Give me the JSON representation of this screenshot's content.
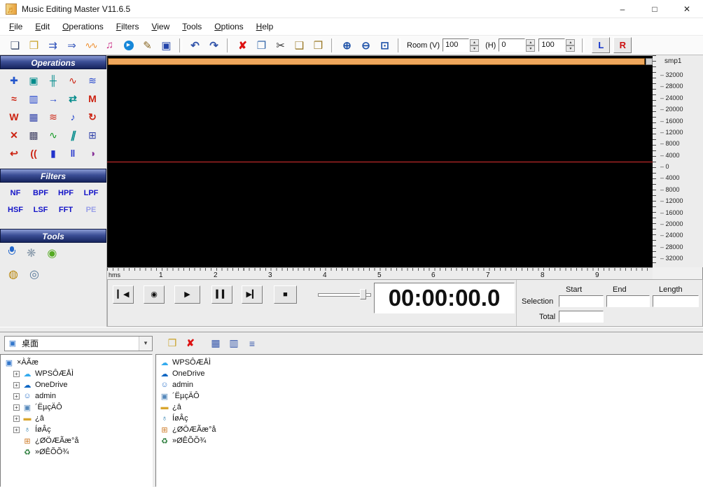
{
  "window": {
    "icon": "♬",
    "title": "Music Editing Master V11.6.5",
    "minimize": "–",
    "maximize": "□",
    "close": "✕"
  },
  "menu": {
    "items": [
      "File",
      "Edit",
      "Operations",
      "Filters",
      "View",
      "Tools",
      "Options",
      "Help"
    ]
  },
  "icons": {
    "up": "▴",
    "down": "▾",
    "plus": "+"
  },
  "toolbar": {
    "icons": [
      {
        "name": "new-document",
        "g": "❏",
        "s": "color:#334466"
      },
      {
        "name": "open-folder",
        "g": "❒",
        "s": "color:#c9a227"
      },
      {
        "name": "extract-convert",
        "g": "⇉",
        "s": "color:#3355bb"
      },
      {
        "name": "batch-convert",
        "g": "⇒",
        "s": "color:#3355bb"
      },
      {
        "name": "audio-wave",
        "g": "∿∿",
        "s": "color:#ee8822;letter-spacing:-2px;font-size:12px"
      },
      {
        "name": "music-note",
        "g": "♫",
        "s": "color:#cc3388"
      },
      {
        "name": "play-media",
        "g": "▶",
        "s": "background:#1687d9;color:#ffffff;border-radius:50%;width:14px;height:14px;line-height:14px;font-size:7px;display:inline-block"
      },
      {
        "name": "edit-pencil",
        "g": "✎",
        "s": "color:#886622"
      },
      {
        "name": "save-disk",
        "g": "▣",
        "s": "color:#2244aa"
      },
      {
        "name": "undo",
        "g": "↶",
        "s": "color:#3355aa;font-weight:bold"
      },
      {
        "name": "redo",
        "g": "↷",
        "s": "color:#3355aa;font-weight:bold"
      },
      {
        "name": "delete",
        "g": "✘",
        "s": "color:#dd1111;font-weight:bold"
      },
      {
        "name": "copy",
        "g": "❐",
        "s": "color:#3366aa"
      },
      {
        "name": "cut",
        "g": "✂",
        "s": "color:#333333"
      },
      {
        "name": "paste",
        "g": "❑",
        "s": "color:#997722"
      },
      {
        "name": "paste-special",
        "g": "❒",
        "s": "color:#997722"
      },
      {
        "name": "zoom-in",
        "g": "⊕",
        "s": "color:#2255aa;font-weight:bold"
      },
      {
        "name": "zoom-out",
        "g": "⊖",
        "s": "color:#2255aa;font-weight:bold"
      },
      {
        "name": "zoom-page",
        "g": "⊡",
        "s": "color:#2255aa;font-weight:bold"
      }
    ],
    "room_label": "Room (V)",
    "room_value": "100",
    "h_label": "(H)",
    "h_value": "0",
    "h_value2": "100",
    "left_button": "L",
    "right_button": "R",
    "left_color": "#1133cc",
    "right_color": "#cc1111"
  },
  "sidebar": {
    "operations": {
      "title": "Operations",
      "icons": [
        {
          "g": "✚",
          "s": "color:#2255cc"
        },
        {
          "g": "▣",
          "s": "color:#008b8b"
        },
        {
          "g": "╫",
          "s": "color:#008b8b"
        },
        {
          "g": "∿",
          "s": "color:#cc2211"
        },
        {
          "g": "≋",
          "s": "color:#2244cc"
        },
        {
          "g": "≈",
          "s": "color:#cc2211;font-weight:bold"
        },
        {
          "g": "▥",
          "s": "color:#2244cc"
        },
        {
          "g": "→",
          "s": "color:#2244cc;font-weight:bold"
        },
        {
          "g": "⇄",
          "s": "color:#008b8b;font-weight:bold"
        },
        {
          "g": "M",
          "s": "color:#cc2211;font-weight:bold"
        },
        {
          "g": "W",
          "s": "color:#cc2211;font-weight:bold"
        },
        {
          "g": "▦",
          "s": "color:#3344aa"
        },
        {
          "g": "≋",
          "s": "color:#cc2211"
        },
        {
          "g": "♪",
          "s": "color:#2244cc"
        },
        {
          "g": "↻",
          "s": "color:#cc2211;font-weight:bold"
        },
        {
          "g": "✕",
          "s": "color:#cc2211;font-weight:bold"
        },
        {
          "g": "▩",
          "s": "color:#444466"
        },
        {
          "g": "∿",
          "s": "color:#119922"
        },
        {
          "g": "∥",
          "s": "color:#008b8b;font-style:italic;font-weight:bold"
        },
        {
          "g": "⊞",
          "s": "color:#3344aa"
        },
        {
          "g": "↩",
          "s": "color:#cc2211;font-weight:bold"
        },
        {
          "g": "((",
          "s": "color:#cc2211;font-weight:bold"
        },
        {
          "g": "▮",
          "s": "color:#2233cc"
        },
        {
          "g": "‖",
          "s": "color:#2233cc;font-weight:bold"
        },
        {
          "g": "◑",
          "s": "color:#883399"
        }
      ]
    },
    "filters": {
      "title": "Filters",
      "buttons": [
        {
          "t": "NF",
          "s": "color:#1414c8"
        },
        {
          "t": "BPF",
          "s": "color:#1414c8"
        },
        {
          "t": "HPF",
          "s": "color:#1414c8"
        },
        {
          "t": "LPF",
          "s": "color:#1414c8"
        },
        {
          "t": "HSF",
          "s": "color:#1414c8"
        },
        {
          "t": "LSF",
          "s": "color:#1414c8"
        },
        {
          "t": "FFT",
          "s": "color:#1414c8"
        },
        {
          "t": "PE",
          "s": "color:#9aa0e8"
        }
      ]
    },
    "tools": {
      "title": "Tools",
      "icons": [
        {
          "name": "microphone"
        },
        {
          "name": "settings",
          "g": "❋",
          "s": "color:#8899aa"
        },
        {
          "name": "cd-green",
          "g": "◉",
          "s": "color:#55aa22"
        },
        {
          "name": "globe",
          "g": "◍",
          "s": "color:#b8860b"
        },
        {
          "name": "cd",
          "g": "◎",
          "s": "color:#557799"
        }
      ]
    }
  },
  "waveform": {
    "scale_title": "smp1",
    "scale_values": [
      "32000",
      "28000",
      "24000",
      "20000",
      "16000",
      "12000",
      "8000",
      "4000",
      "0",
      "4000",
      "8000",
      "12000",
      "16000",
      "20000",
      "24000",
      "28000",
      "32000"
    ]
  },
  "ruler": {
    "unit": "hms",
    "ticks": [
      "1",
      "2",
      "3",
      "4",
      "5",
      "6",
      "7",
      "8",
      "9"
    ]
  },
  "transport": {
    "buttons": [
      {
        "name": "skip-start",
        "g": "▎◀",
        "s": "color:#111"
      },
      {
        "name": "play-selection",
        "g": "◉",
        "s": "color:#bb2222"
      },
      {
        "name": "play",
        "g": "▶",
        "s": "color:#111"
      },
      {
        "name": "pause",
        "g": "▍▍",
        "s": "color:#111;letter-spacing:-1px"
      },
      {
        "name": "step-forward",
        "g": "▶▎",
        "s": "color:#111"
      },
      {
        "name": "stop",
        "g": "■",
        "s": "color:#111"
      }
    ],
    "time": "00:00:00.0"
  },
  "selection": {
    "start_label": "Start",
    "end_label": "End",
    "length_label": "Length",
    "selection_label": "Selection",
    "total_label": "Total",
    "start_value": "",
    "end_value": "",
    "length_value": "",
    "total_value": ""
  },
  "browser": {
    "location": "桌面",
    "location_icon": {
      "g": "▣",
      "s": "color:#3377cc"
    },
    "buttons": [
      {
        "name": "open-folder",
        "g": "❒",
        "s": "color:#c9a227"
      },
      {
        "name": "delete",
        "g": "✘",
        "s": "color:#dd1111;font-weight:bold"
      },
      {
        "name": "large-icons-view",
        "g": "▦",
        "s": "color:#3355aa"
      },
      {
        "name": "small-icons-view",
        "g": "▥",
        "s": "color:#3355aa"
      },
      {
        "name": "list-view",
        "g": "≡",
        "s": "color:#3355aa;font-weight:bold"
      }
    ],
    "tree": [
      {
        "label": "×ÀÃæ",
        "icon": "▣",
        "ic": "color:#3377cc",
        "expand": false
      },
      {
        "label": "WPSÔÆÅÌ",
        "icon": "☁",
        "ic": "color:#33aaee",
        "expand": true
      },
      {
        "label": "OneDrive",
        "icon": "☁",
        "ic": "color:#0b66c3",
        "expand": true
      },
      {
        "label": "admin",
        "icon": "☺",
        "ic": "color:#3377cc",
        "expand": true
      },
      {
        "label": "´ËµçÄÔ",
        "icon": "▣",
        "ic": "color:#5588bb",
        "expand": true
      },
      {
        "label": "¿â",
        "icon": "▬",
        "ic": "color:#d9a62e",
        "expand": true
      },
      {
        "label": "ÍøÂç",
        "icon": "♁",
        "ic": "color:#2277aa",
        "expand": true
      },
      {
        "label": "¿ØÖÆÃæ°å",
        "icon": "⊞",
        "ic": "color:#cc7722",
        "expand": false
      },
      {
        "label": "»ØÊÕÕ¾",
        "icon": "♻",
        "ic": "color:#227733",
        "expand": false
      }
    ],
    "files": [
      {
        "label": "WPSÔÆÅÌ",
        "icon": "☁",
        "ic": "color:#33aaee"
      },
      {
        "label": "OneDrive",
        "icon": "☁",
        "ic": "color:#0b66c3"
      },
      {
        "label": "admin",
        "icon": "☺",
        "ic": "color:#3377cc"
      },
      {
        "label": "´ËµçÄÔ",
        "icon": "▣",
        "ic": "color:#5588bb"
      },
      {
        "label": "¿â",
        "icon": "▬",
        "ic": "color:#d9a62e"
      },
      {
        "label": "ÍøÂç",
        "icon": "♁",
        "ic": "color:#2277aa"
      },
      {
        "label": "¿ØÖÆÃæ°å",
        "icon": "⊞",
        "ic": "color:#cc7722"
      },
      {
        "label": "»ØÊÕÕ¾",
        "icon": "♻",
        "ic": "color:#227733"
      }
    ]
  }
}
